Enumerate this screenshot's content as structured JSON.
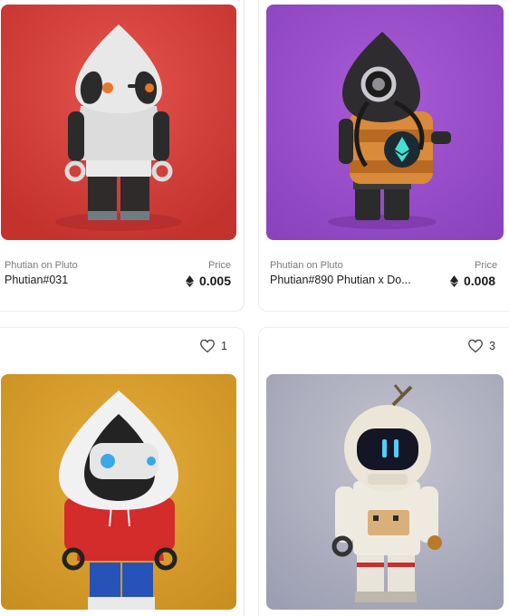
{
  "cards": [
    {
      "collection": "Phutian on Pluto",
      "name": "Phutian#031",
      "price_label": "Price",
      "price": "0.005",
      "bg_color": "#d9433d",
      "image_icon": "phutian-ghost-figure"
    },
    {
      "collection": "Phutian on Pluto",
      "name": "Phutian#890 Phutian x Do...",
      "price_label": "Price",
      "price": "0.008",
      "bg_color": "#9a4fc9",
      "image_icon": "phutian-diver-figure"
    },
    {
      "likes": "1",
      "bg_color": "#d8a02c",
      "image_icon": "phutian-hoodie-figure"
    },
    {
      "likes": "3",
      "bg_color": "#a9abbd",
      "image_icon": "phutian-astronaut-figure"
    }
  ],
  "icons": {
    "heart": "heart-icon",
    "eth": "ethereum-icon"
  }
}
